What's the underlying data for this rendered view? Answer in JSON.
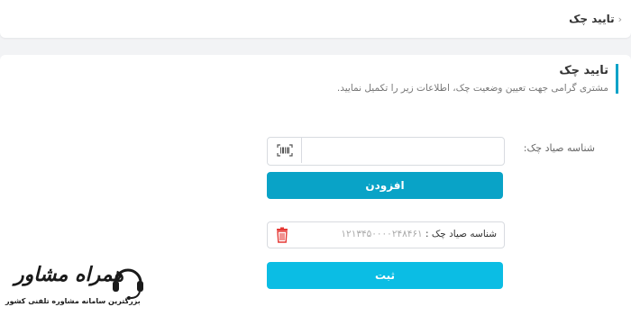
{
  "header": {
    "breadcrumb": "تایید چک"
  },
  "main": {
    "title": "تایید چک",
    "subtitle": "مشتری گرامی جهت تعیین وضعیت چک، اطلاعات زیر را تکمیل نمایید."
  },
  "form": {
    "label": "شناسه صیاد چک:",
    "input_value": "",
    "add_button": "افزودن",
    "submit_button": "ثبت"
  },
  "entry": {
    "label": "شناسه صیاد چک :",
    "value": "۱۲۱۳۴۵۰۰۰۰۲۴۸۴۶۱"
  },
  "watermark": {
    "name": "همراه مشاور",
    "tagline": "بزرگترین سامانه مشاوره تلفنی کشور"
  },
  "icons": {
    "barcode": "barcode-icon",
    "trash": "trash-icon",
    "chevron": "chevron-left-icon"
  },
  "colors": {
    "accent": "#00a2c8",
    "add_button": "#09a3c7",
    "submit_button": "#0bbde4",
    "trash": "#e53935"
  }
}
